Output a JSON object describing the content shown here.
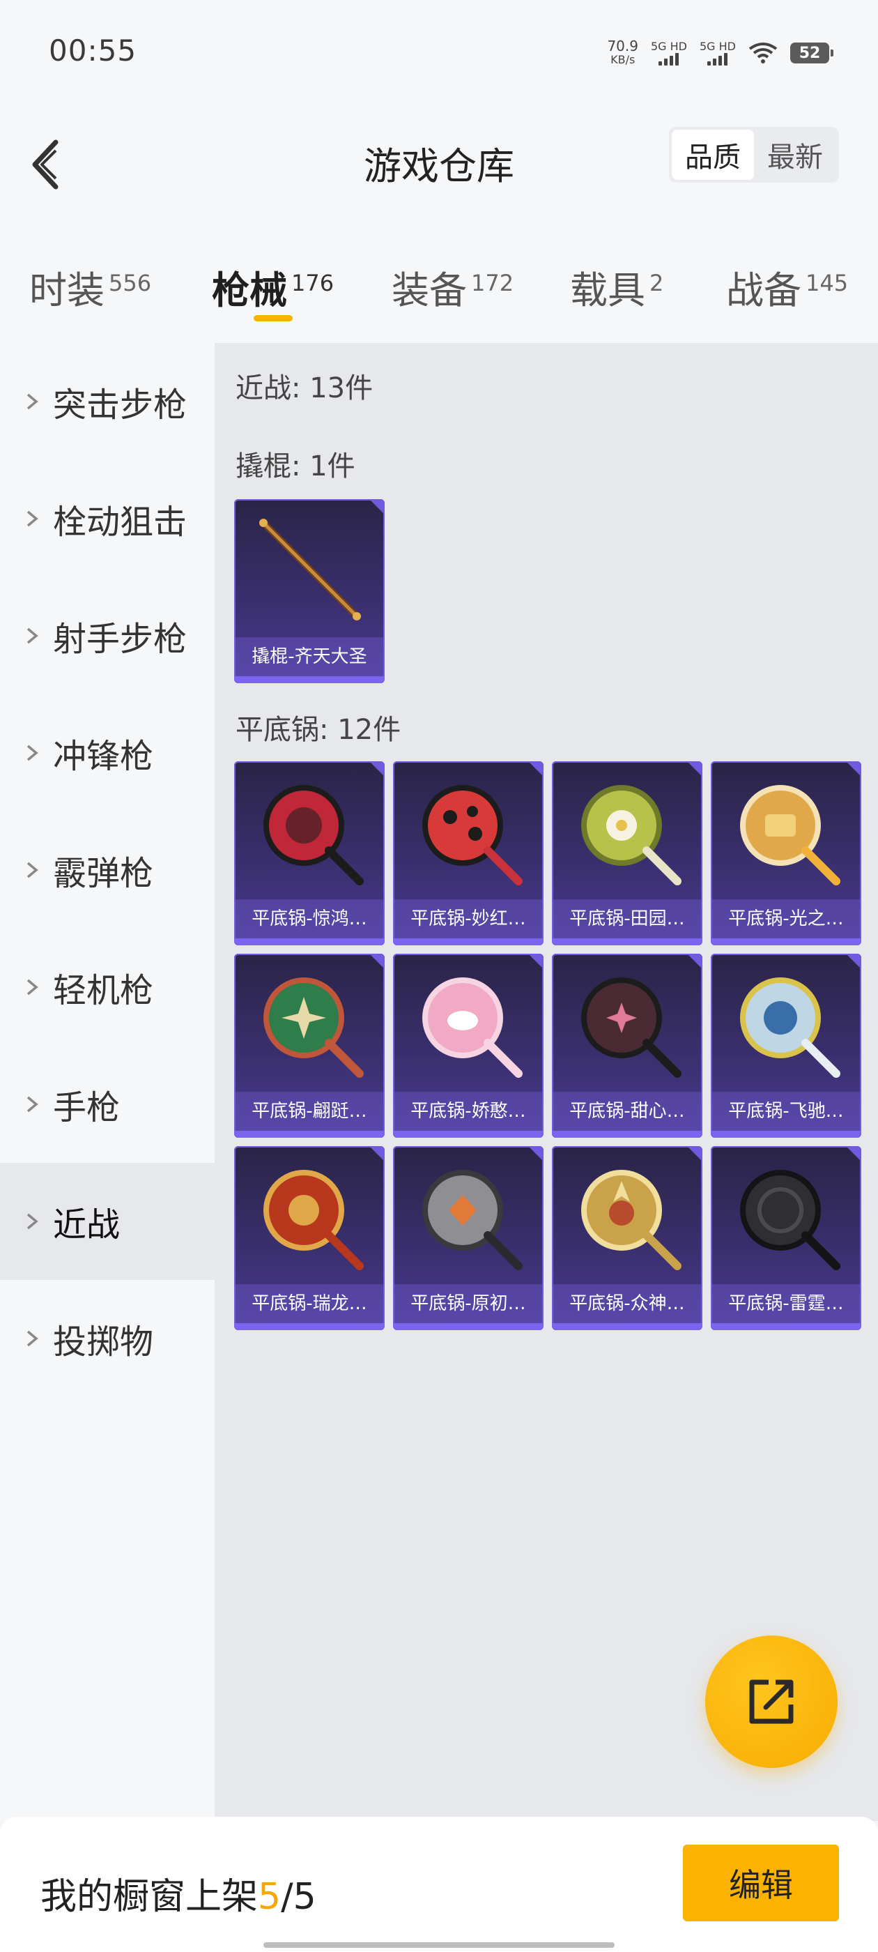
{
  "status_bar": {
    "time": "00:55",
    "net_speed": "70.9",
    "net_unit": "KB/s",
    "sim1": "5G HD",
    "sim2": "5G HD",
    "battery": "52"
  },
  "header": {
    "title": "游戏仓库",
    "sort_options": [
      "品质",
      "最新"
    ],
    "sort_selected": "品质"
  },
  "tabs": [
    {
      "label": "时装",
      "count": "556"
    },
    {
      "label": "枪械",
      "count": "176",
      "active": true
    },
    {
      "label": "装备",
      "count": "172"
    },
    {
      "label": "载具",
      "count": "2"
    },
    {
      "label": "战备",
      "count": "145"
    }
  ],
  "sidebar": {
    "items": [
      "突击步枪",
      "栓动狙击",
      "射手步枪",
      "冲锋枪",
      "霰弹枪",
      "轻机枪",
      "手枪",
      "近战",
      "投掷物"
    ],
    "active": "近战"
  },
  "content": {
    "summary": "近战: 13件",
    "groups": [
      {
        "label": "撬棍: 1件",
        "items": [
          {
            "name": "撬棍-齐天大圣",
            "icon": "crowbar-icon"
          }
        ]
      },
      {
        "label": "平底锅: 12件",
        "items": [
          {
            "name": "平底锅-惊鸿…",
            "icon": "pan-icon",
            "color": "#c0283a"
          },
          {
            "name": "平底锅-妙红…",
            "icon": "pan-icon",
            "color": "#d83a3a"
          },
          {
            "name": "平底锅-田园…",
            "icon": "pan-icon",
            "color": "#b6c24a"
          },
          {
            "name": "平底锅-光之…",
            "icon": "pan-icon",
            "color": "#e0a848"
          },
          {
            "name": "平底锅-翩跹…",
            "icon": "pan-icon",
            "color": "#2e7d4a"
          },
          {
            "name": "平底锅-娇憨…",
            "icon": "pan-icon",
            "color": "#f2a9c4"
          },
          {
            "name": "平底锅-甜心…",
            "icon": "pan-icon",
            "color": "#4a2a33"
          },
          {
            "name": "平底锅-飞驰…",
            "icon": "pan-icon",
            "color": "#d9c34a"
          },
          {
            "name": "平底锅-瑞龙…",
            "icon": "pan-icon",
            "color": "#b8381e"
          },
          {
            "name": "平底锅-原初…",
            "icon": "pan-icon",
            "color": "#8f8f93"
          },
          {
            "name": "平底锅-众神…",
            "icon": "pan-icon",
            "color": "#c9a24a"
          },
          {
            "name": "平底锅-雷霆…",
            "icon": "pan-icon",
            "color": "#2f2f33"
          }
        ]
      }
    ]
  },
  "fab_icon": "share-icon",
  "bottom_bar": {
    "prefix": "我的橱窗上架",
    "current": "5",
    "separator": "/",
    "total": "5",
    "edit_label": "编辑"
  },
  "colors": {
    "accent": "#fbb300",
    "card_border": "#6f5ae0"
  }
}
